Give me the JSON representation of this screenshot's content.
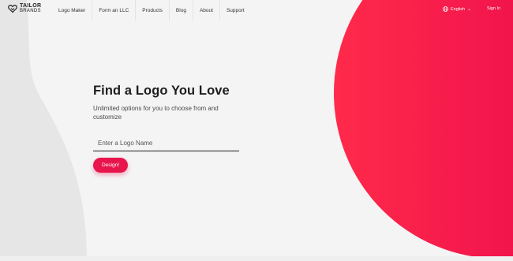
{
  "brand": {
    "name_top": "TAILOR",
    "name_bottom": "BRANDS"
  },
  "nav": {
    "items": [
      "Logo Maker",
      "Form an LLC",
      "Products",
      "Blog",
      "About",
      "Support"
    ]
  },
  "header_right": {
    "language": "English",
    "signin": "Sign In"
  },
  "hero": {
    "title": "Find a Logo You Love",
    "subtitle": "Unlimited options for you to choose from and customize",
    "input_placeholder": "Enter a Logo Name",
    "button_label": "Design!"
  },
  "colors": {
    "accent": "#e8154d",
    "circle_start": "#ff2a4a",
    "circle_end": "#e4004f",
    "background": "#f4f4f5",
    "wave": "#e6e6e7"
  },
  "icons": [
    "tailor-brands-logo-icon",
    "globe-icon",
    "chevron-down-icon"
  ]
}
